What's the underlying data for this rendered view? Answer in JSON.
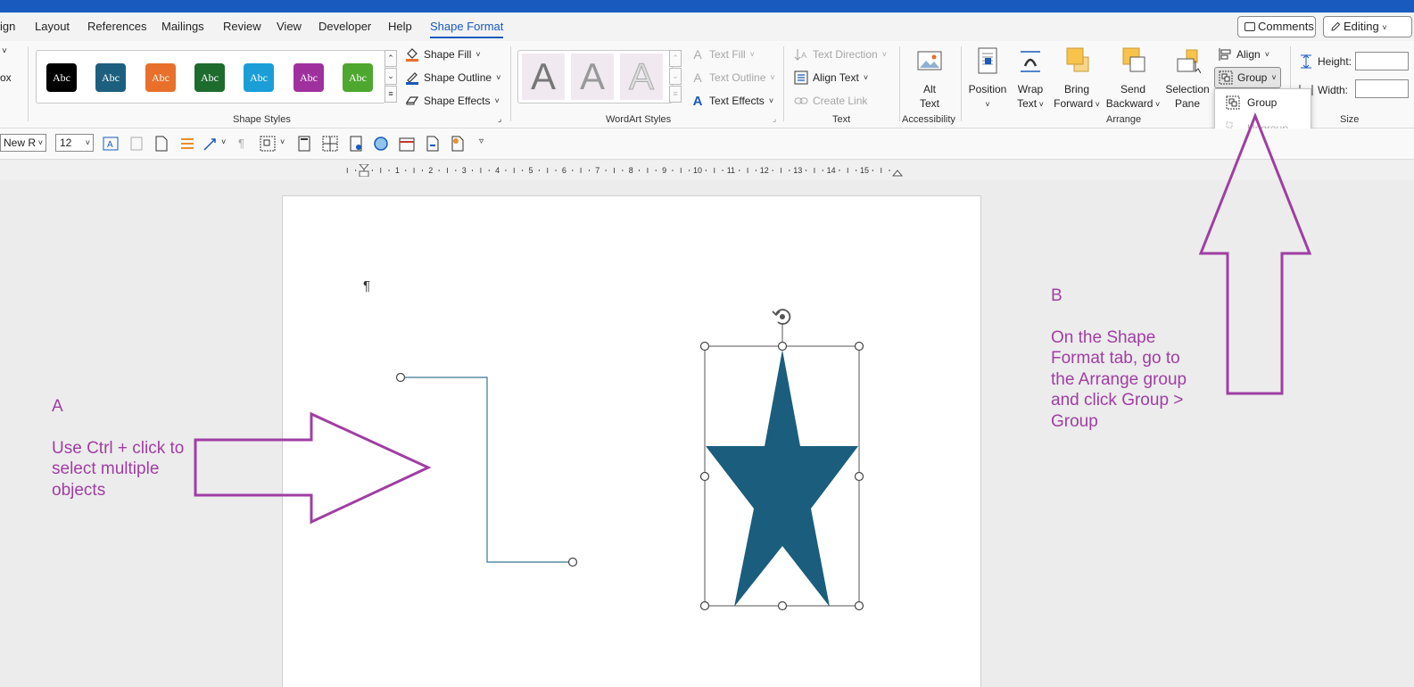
{
  "window": {
    "accent": "#185abd"
  },
  "tabs": [
    {
      "label": "ign"
    },
    {
      "label": "Layout"
    },
    {
      "label": "References"
    },
    {
      "label": "Mailings"
    },
    {
      "label": "Review"
    },
    {
      "label": "View"
    },
    {
      "label": "Developer"
    },
    {
      "label": "Help"
    },
    {
      "label": "Shape Format",
      "active": true
    }
  ],
  "header_buttons": {
    "comments": "Comments",
    "editing": "Editing"
  },
  "ribbon": {
    "left_stub": {
      "caret": "˅",
      "label": "ox"
    },
    "shape_styles": {
      "label": "Shape Styles",
      "swatches": [
        {
          "text": "Abc",
          "color": "#000000"
        },
        {
          "text": "Abc",
          "color": "#1d5f7e"
        },
        {
          "text": "Abc",
          "color": "#e8702a"
        },
        {
          "text": "Abc",
          "color": "#1e6b2e"
        },
        {
          "text": "Abc",
          "color": "#1b9ed8"
        },
        {
          "text": "Abc",
          "color": "#a0309e"
        },
        {
          "text": "Abc",
          "color": "#4ea72e"
        }
      ],
      "shape_fill": "Shape Fill",
      "shape_outline": "Shape Outline",
      "shape_effects": "Shape Effects"
    },
    "wordart_styles": {
      "label": "WordArt Styles",
      "letters": [
        "A",
        "A",
        "A"
      ],
      "text_fill": "Text Fill",
      "text_outline": "Text Outline",
      "text_effects": "Text Effects"
    },
    "text_group": {
      "label": "Text",
      "text_direction": "Text Direction",
      "align_text": "Align Text",
      "create_link": "Create Link"
    },
    "accessibility": {
      "label": "Accessibility",
      "alt_text_line1": "Alt",
      "alt_text_line2": "Text"
    },
    "arrange": {
      "label": "Arrange",
      "position": "Position",
      "wrap_text_1": "Wrap",
      "wrap_text_2": "Text",
      "bring_forward_1": "Bring",
      "bring_forward_2": "Forward",
      "send_backward_1": "Send",
      "send_backward_2": "Backward",
      "selection_pane_1": "Selection",
      "selection_pane_2": "Pane",
      "align": "Align",
      "group": "Group"
    },
    "size": {
      "label": "Size",
      "height": "Height:",
      "width": "Width:"
    }
  },
  "group_dropdown": {
    "items": [
      {
        "label": "Group",
        "enabled": true
      },
      {
        "label": "Ungroup",
        "enabled": false
      }
    ]
  },
  "toolbar2": {
    "font": "New R",
    "size": "12"
  },
  "ruler": {
    "numbers": [
      "1",
      "2",
      "3",
      "4",
      "5",
      "6",
      "7",
      "8",
      "9",
      "10",
      "11",
      "12",
      "13",
      "14",
      "15"
    ]
  },
  "document": {
    "pilcrow": "¶",
    "star_color": "#1b5d7c"
  },
  "annotations": {
    "a": {
      "letter": "A",
      "text": "Use Ctrl + click to\nselect multiple\nobjects",
      "color": "#a03ea3"
    },
    "b": {
      "letter": "B",
      "text": "On the Shape\nFormat tab, go to\nthe Arrange group\nand click Group >\nGroup",
      "color": "#a03ea3"
    }
  }
}
